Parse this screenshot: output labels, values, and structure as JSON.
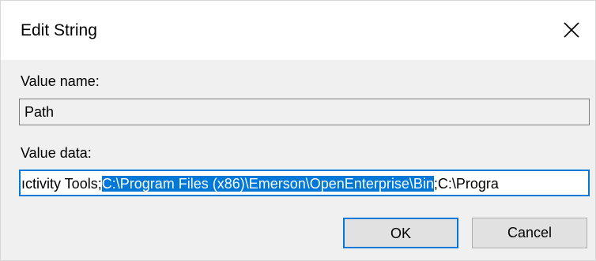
{
  "window": {
    "title": "Edit String",
    "close_icon": "close-icon"
  },
  "value_name": {
    "label": "Value name:",
    "value": "Path"
  },
  "value_data": {
    "label": "Value data:",
    "text_before": "ıctivity Tools;",
    "text_selected": "C:\\Program Files (x86)\\Emerson\\OpenEnterprise\\Bin",
    "text_after": ";C:\\Progra"
  },
  "buttons": {
    "ok": "OK",
    "cancel": "Cancel"
  },
  "colors": {
    "accent": "#0078d7",
    "dialog_bg": "#f0f0f0",
    "title_bg": "#ffffff"
  }
}
